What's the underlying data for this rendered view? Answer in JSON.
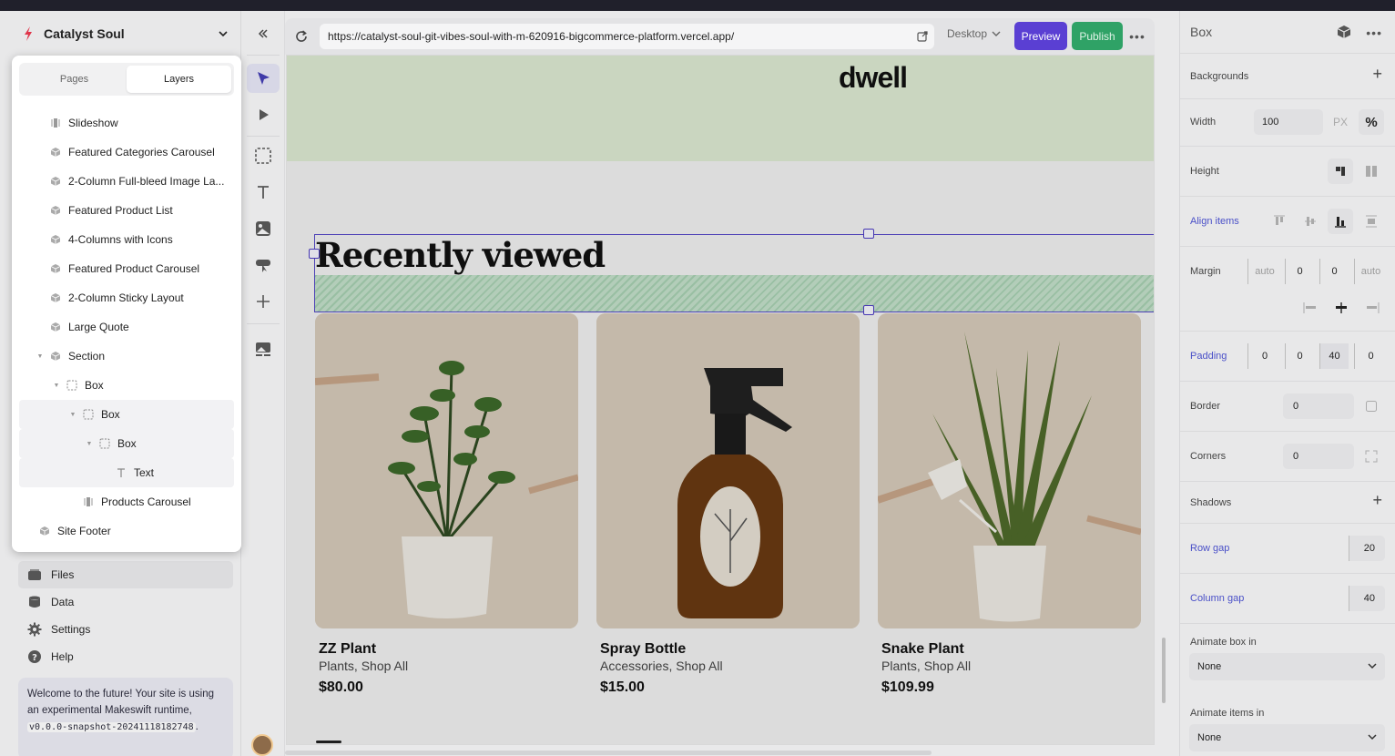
{
  "site": {
    "name": "Catalyst Soul"
  },
  "layers_panel": {
    "tabs": [
      "Pages",
      "Layers"
    ],
    "active_tab": "Layers",
    "items": [
      {
        "label": "Slideshow",
        "indent": 1,
        "icon": "component-icon",
        "twisty": false
      },
      {
        "label": "Featured Categories Carousel",
        "indent": 1,
        "icon": "cube-icon",
        "twisty": false
      },
      {
        "label": "2-Column Full-bleed Image La...",
        "indent": 1,
        "icon": "cube-icon",
        "twisty": false
      },
      {
        "label": "Featured Product List",
        "indent": 1,
        "icon": "cube-icon",
        "twisty": false
      },
      {
        "label": "4-Columns with Icons",
        "indent": 1,
        "icon": "cube-icon",
        "twisty": false
      },
      {
        "label": "Featured Product Carousel",
        "indent": 1,
        "icon": "cube-icon",
        "twisty": false
      },
      {
        "label": "2-Column Sticky Layout",
        "indent": 1,
        "icon": "cube-icon",
        "twisty": false
      },
      {
        "label": "Large Quote",
        "indent": 1,
        "icon": "cube-icon",
        "twisty": false
      },
      {
        "label": "Section",
        "indent": 1,
        "icon": "cube-icon",
        "twisty": true
      },
      {
        "label": "Box",
        "indent": 2,
        "icon": "box-icon",
        "twisty": true
      },
      {
        "label": "Box",
        "indent": 3,
        "icon": "box-icon",
        "twisty": true,
        "selected": true
      },
      {
        "label": "Box",
        "indent": 4,
        "icon": "box-icon",
        "twisty": true,
        "selected": true
      },
      {
        "label": "Text",
        "indent": 5,
        "icon": "text-icon",
        "twisty": false,
        "selected": true
      },
      {
        "label": "Products Carousel",
        "indent": 3,
        "icon": "component-icon",
        "twisty": false
      },
      {
        "label": "Site Footer",
        "indent": 0,
        "icon": "cube-icon",
        "twisty": false
      }
    ]
  },
  "menu": [
    {
      "label": "Files",
      "icon": "files-icon"
    },
    {
      "label": "Data",
      "icon": "database-icon"
    },
    {
      "label": "Settings",
      "icon": "gear-icon"
    },
    {
      "label": "Help",
      "icon": "help-icon"
    }
  ],
  "welcome": {
    "text": "Welcome to the future! Your site is using an experimental Makeswift runtime,",
    "version": "v0.0.0-snapshot-20241118182748",
    "suffix": "."
  },
  "toolbar": {
    "url": "https://catalyst-soul-git-vibes-soul-with-m-620916-bigcommerce-platform.vercel.app/",
    "device": "Desktop",
    "preview": "Preview",
    "publish": "Publish"
  },
  "canvas": {
    "brand": "dwell",
    "section_title": "Recently viewed",
    "products": [
      {
        "name": "ZZ Plant",
        "category": "Plants, Shop All",
        "price": "$80.00"
      },
      {
        "name": "Spray Bottle",
        "category": "Accessories, Shop All",
        "price": "$15.00"
      },
      {
        "name": "Snake Plant",
        "category": "Plants, Shop All",
        "price": "$109.99"
      }
    ]
  },
  "inspector": {
    "title": "Box",
    "backgrounds": "Backgrounds",
    "width": {
      "label": "Width",
      "value": "100",
      "unit_px": "PX",
      "unit_pct": "%"
    },
    "height": {
      "label": "Height"
    },
    "align_items": {
      "label": "Align items"
    },
    "margin": {
      "label": "Margin",
      "values": [
        "auto",
        "0",
        "0",
        "auto"
      ]
    },
    "padding": {
      "label": "Padding",
      "values": [
        "0",
        "0",
        "40",
        "0"
      ]
    },
    "border": {
      "label": "Border",
      "value": "0"
    },
    "corners": {
      "label": "Corners",
      "value": "0"
    },
    "shadows": {
      "label": "Shadows"
    },
    "row_gap": {
      "label": "Row gap",
      "value": "20"
    },
    "column_gap": {
      "label": "Column gap",
      "value": "40"
    },
    "animate_box": {
      "label": "Animate box in",
      "value": "None"
    },
    "animate_items": {
      "label": "Animate items in",
      "value": "None"
    }
  },
  "colors": {
    "accent": "#5a3fd3",
    "publish": "#2fa266",
    "selection": "#5548c8",
    "link_label": "#4a50c8"
  }
}
